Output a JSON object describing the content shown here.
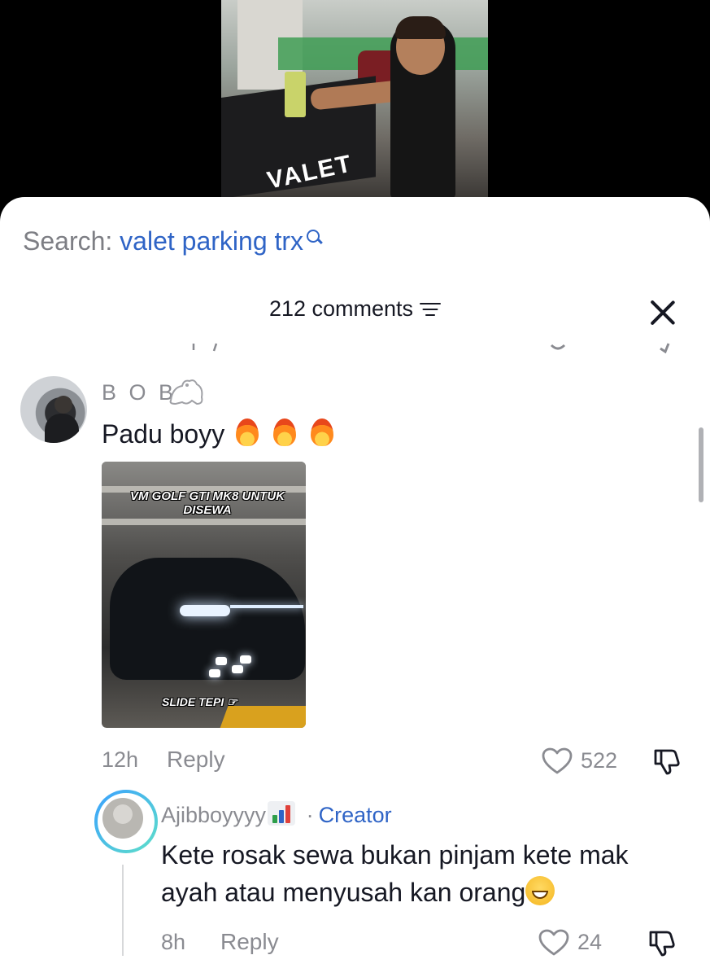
{
  "video": {
    "counter_text": "VALET"
  },
  "search": {
    "prefix": "Search:",
    "term": "valet parking trx"
  },
  "comments": {
    "header": "212 comments"
  },
  "comment_bob": {
    "username": "B O B",
    "text": "Padu boyy",
    "image": {
      "title": "VM GOLF GTI MK8 UNTUK DISEWA",
      "caption": "SLIDE TEPI"
    },
    "time": "12h",
    "reply_label": "Reply",
    "likes": "522"
  },
  "reply_ajib": {
    "username": "Ajibboyyyy",
    "separator": "·",
    "badge": "Creator",
    "text": "Kete rosak sewa bukan pinjam kete mak ayah atau menyusah kan orang",
    "time": "8h",
    "reply_label": "Reply",
    "likes": "24"
  },
  "colors": {
    "link_blue": "#2f64c6",
    "muted_gray": "#8a8b91",
    "text_dark": "#161823"
  },
  "icons": [
    "search-icon",
    "filter-icon",
    "close-icon",
    "frog-icon",
    "fire-icon",
    "heart-icon",
    "dislike-icon",
    "chart-icon",
    "grin-emoji"
  ]
}
